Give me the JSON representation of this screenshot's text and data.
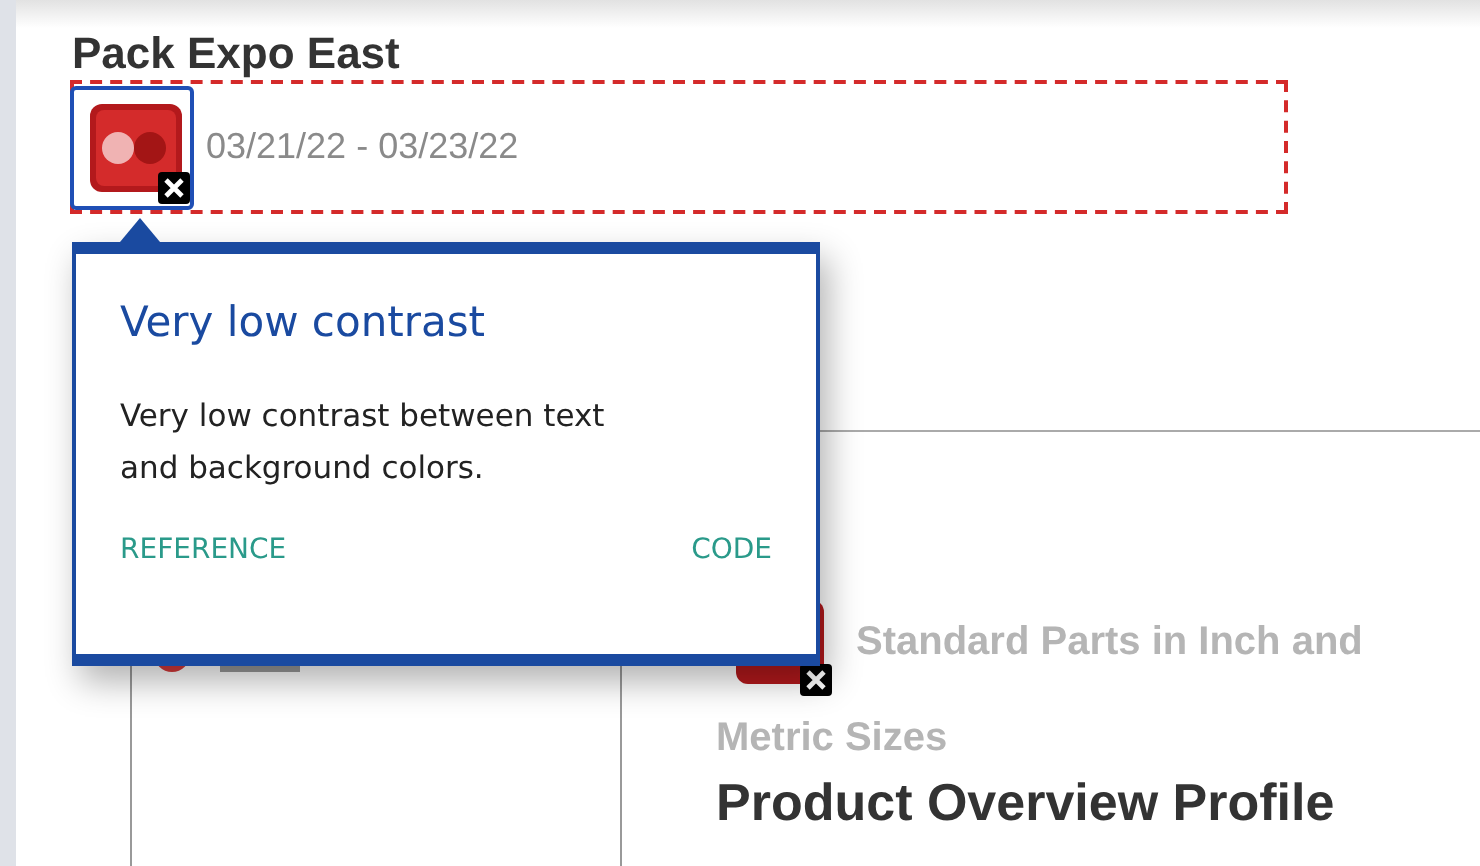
{
  "event": {
    "title": "Pack Expo East",
    "dates": "03/21/22 - 03/23/22"
  },
  "issue_markers": [
    {
      "selected": true
    },
    {
      "selected": false
    }
  ],
  "popup": {
    "title": "Very low contrast",
    "description": "Very low contrast between text and background colors.",
    "links": [
      "REFERENCE",
      "CODE"
    ]
  },
  "product": {
    "subtitle_lines": [
      "Standard Parts in Inch and",
      "Metric Sizes"
    ],
    "title": "Product Overview Profile"
  }
}
